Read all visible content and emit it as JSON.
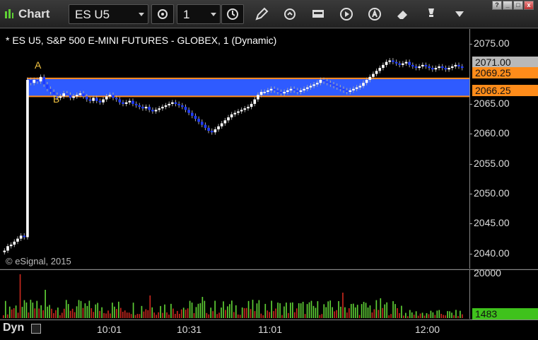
{
  "app": {
    "title": "Chart"
  },
  "toolbar": {
    "symbol": "ES U5",
    "interval": "1",
    "tools": [
      "settings-icon",
      "clock-icon",
      "pencil-icon",
      "redraw-icon",
      "data-icon",
      "play-icon",
      "alert-icon",
      "eraser-icon",
      "marker-icon",
      "dropdown-icon"
    ]
  },
  "window_buttons": [
    "?",
    "_",
    "□",
    "x"
  ],
  "chart": {
    "title": "* ES U5, S&P 500 E-MINI FUTURES - GLOBEX, 1 (Dynamic)",
    "copyright": "© eSignal, 2015",
    "price_ticks": [
      "2075.00",
      "2065.00",
      "2060.00",
      "2055.00",
      "2050.00",
      "2045.00",
      "2040.00"
    ],
    "last_price": "2071.00",
    "zone_top_label": "2069.25",
    "zone_bottom_label": "2066.25",
    "zone_label_a": "A",
    "zone_label_b": "B",
    "volume_tick": "20000",
    "volume_last": "1483",
    "time_ticks": [
      "10:01",
      "10:31",
      "11:01",
      "12:00"
    ],
    "period_label": "Dyn",
    "colors": {
      "up": "#ffffff",
      "down": "#1f3cff",
      "zone": "#2f5bff",
      "zone_border": "#ff8c1a",
      "vol_up": "#5fd035",
      "vol_down": "#c8281e",
      "last_tag": "#b9b9b9",
      "vol_tag": "#3fc21c"
    }
  },
  "chart_data": {
    "type": "candlestick",
    "title": "* ES U5, S&P 500 E-MINI FUTURES - GLOBEX, 1 (Dynamic)",
    "ylim": [
      2037.5,
      2077.5
    ],
    "zone": [
      2066.25,
      2069.25
    ],
    "last": 2071.0,
    "x_ticks": [
      "10:01",
      "10:31",
      "11:01",
      "12:00"
    ],
    "closes": [
      2040.5,
      2041.25,
      2041.5,
      2042,
      2042.5,
      2043,
      2042.75,
      2069,
      2068.5,
      2069,
      2068.75,
      2069.5,
      2068.25,
      2067.5,
      2067,
      2066.5,
      2066,
      2066.25,
      2066.75,
      2066.5,
      2066,
      2066.25,
      2066.5,
      2066.75,
      2066.25,
      2065.75,
      2065.5,
      2066,
      2065.5,
      2065.25,
      2065.75,
      2066.25,
      2066.5,
      2066,
      2065.75,
      2065.25,
      2065,
      2065.25,
      2065.5,
      2065,
      2064.75,
      2064.5,
      2064.25,
      2064.5,
      2064,
      2063.75,
      2064,
      2064.25,
      2064.5,
      2064.75,
      2065,
      2065.25,
      2065,
      2064.75,
      2064.5,
      2064,
      2063.5,
      2063,
      2062.5,
      2062,
      2061.5,
      2061,
      2060.5,
      2060.25,
      2060.75,
      2061.25,
      2061.75,
      2062.25,
      2062.75,
      2063.25,
      2063.5,
      2063.75,
      2064,
      2064.25,
      2064.5,
      2065,
      2065.75,
      2066.5,
      2067,
      2067,
      2067.25,
      2067.5,
      2067.25,
      2067,
      2066.75,
      2067,
      2067.25,
      2067.5,
      2067.25,
      2067,
      2067.25,
      2067.5,
      2067.75,
      2068,
      2068.25,
      2068.5,
      2069,
      2068.75,
      2068.5,
      2068.25,
      2068,
      2067.75,
      2067.5,
      2067.25,
      2067,
      2067.25,
      2067.5,
      2067.75,
      2068,
      2068.5,
      2069,
      2069.5,
      2070,
      2070.5,
      2071,
      2071.5,
      2072,
      2072.25,
      2072,
      2071.75,
      2071.5,
      2071.75,
      2072,
      2071.5,
      2071.25,
      2071,
      2071.25,
      2071.5,
      2071.25,
      2071,
      2070.75,
      2071,
      2071.25,
      2071,
      2070.75,
      2071,
      2071.25,
      2071.5,
      2071.25,
      2071
    ],
    "volume_max": 20000,
    "volume_last": 1483
  }
}
